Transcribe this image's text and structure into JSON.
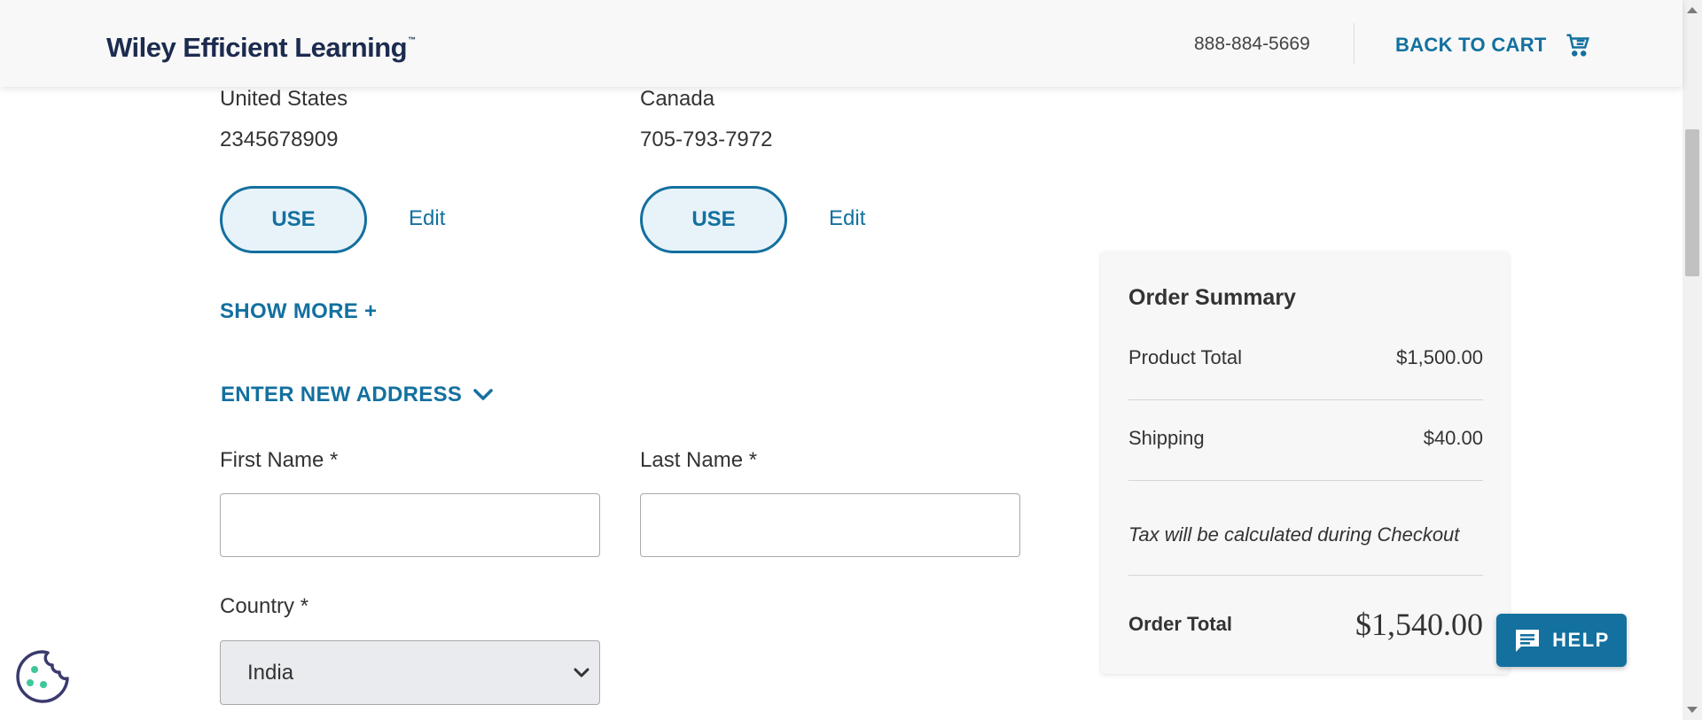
{
  "header": {
    "logo_text": "Wiley Efficient Learning",
    "logo_tm": "™",
    "phone": "888-884-5669",
    "back_to_cart": "BACK TO CART",
    "cart_icon": "cart-icon"
  },
  "addresses": [
    {
      "country": "United States",
      "phone": "2345678909",
      "use_label": "USE",
      "edit_label": "Edit"
    },
    {
      "country": "Canada",
      "phone": "705-793-7972",
      "use_label": "USE",
      "edit_label": "Edit"
    }
  ],
  "show_more": "SHOW MORE +",
  "enter_new_address": "ENTER NEW ADDRESS",
  "form": {
    "first_name_label": "First Name *",
    "last_name_label": "Last Name *",
    "country_label": "Country *",
    "first_name_value": "",
    "last_name_value": "",
    "country_selected": "India"
  },
  "order_summary": {
    "title": "Order Summary",
    "product_total_label": "Product Total",
    "product_total_value": "$1,500.00",
    "shipping_label": "Shipping",
    "shipping_value": "$40.00",
    "tax_note": "Tax will be calculated during Checkout",
    "order_total_label": "Order Total",
    "order_total_value": "$1,540.00"
  },
  "help": {
    "label": "HELP",
    "icon": "chat-icon"
  },
  "cookie": {
    "icon": "cookie-icon"
  },
  "colors": {
    "brand_blue": "#13709f",
    "logo_navy": "#1c2b4f",
    "use_button_bg": "#e8f3f9",
    "select_bg": "#e9ebee"
  }
}
